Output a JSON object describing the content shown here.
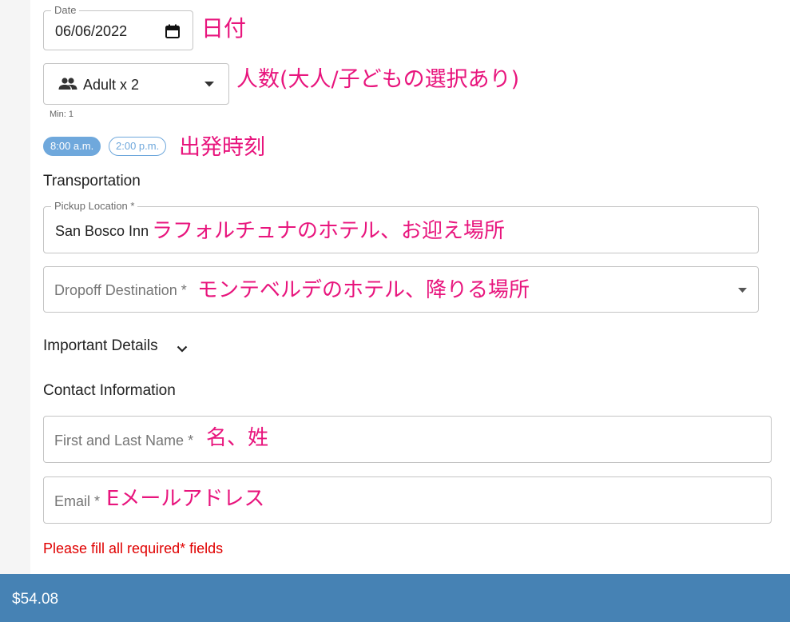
{
  "date_field": {
    "legend": "Date",
    "value": "06/06/2022",
    "annotation": "日付"
  },
  "guests": {
    "value": "Adult x 2",
    "hint": "Min: 1",
    "annotation": "人数(大人/子どもの選択あり)"
  },
  "times": {
    "slots": [
      "8:00 a.m.",
      "2:00 p.m."
    ],
    "selected": "8:00 a.m.",
    "annotation": "出発時刻"
  },
  "transportation": {
    "title": "Transportation",
    "pickup": {
      "legend": "Pickup Location *",
      "value": "San Bosco Inn",
      "annotation": "ラフォルチュナのホテル、お迎え場所"
    },
    "dropoff": {
      "placeholder": "Dropoff Destination *",
      "annotation": "モンテベルデのホテル、降りる場所"
    }
  },
  "important_details": {
    "title": "Important Details"
  },
  "contact": {
    "title": "Contact Information",
    "name": {
      "placeholder": "First and Last Name *",
      "annotation": "名、姓"
    },
    "email": {
      "placeholder": "Email *",
      "annotation": "Eメールアドレス"
    }
  },
  "error_message": "Please fill all required* fields",
  "footer": {
    "price": "$54.08"
  },
  "colors": {
    "annotation": "#e8157d",
    "chip_selected": "#6fa8dc",
    "footer": "#4682b4",
    "error": "#e00000"
  },
  "icons": {
    "calendar": "calendar-icon",
    "people": "people-icon",
    "dropdown": "caret-down-icon",
    "expand": "chevron-down-icon"
  }
}
